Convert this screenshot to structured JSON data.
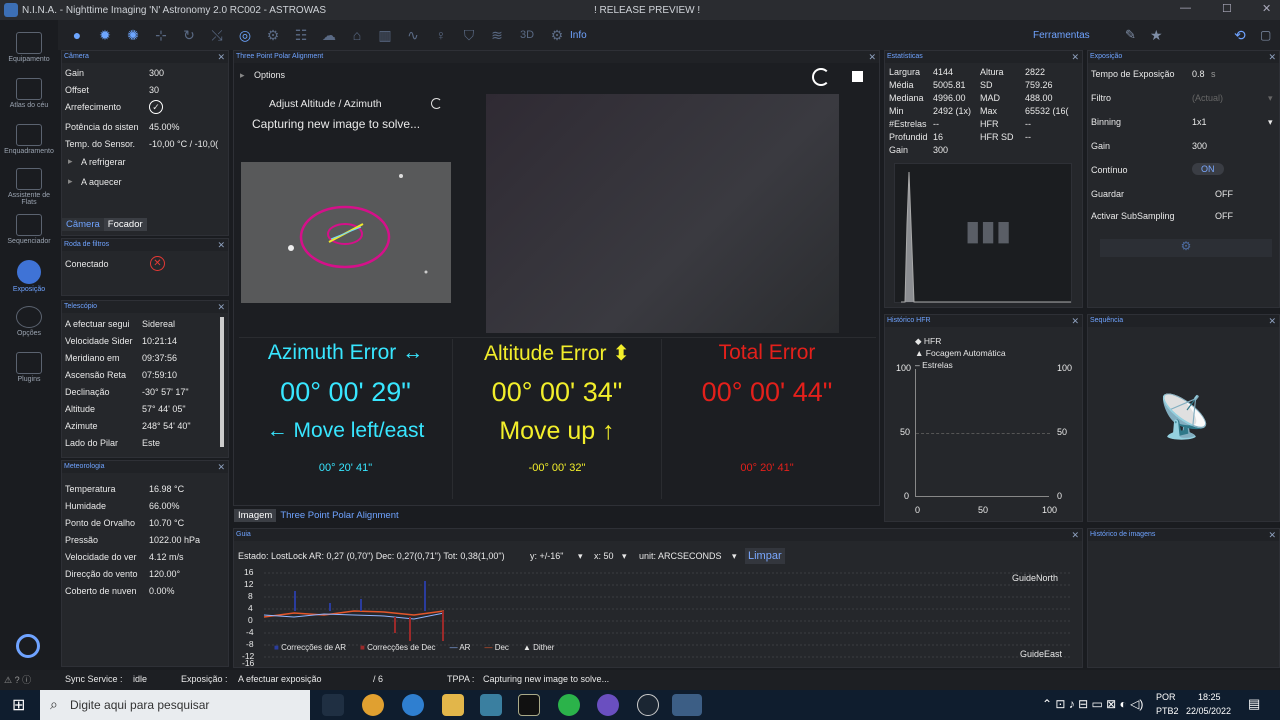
{
  "window": {
    "title": "N.I.N.A. - Nighttime Imaging 'N' Astronomy 2.0 RC002  -  ASTROWAS",
    "center": "! RELEASE PREVIEW !"
  },
  "toolbar": {
    "info": "Info",
    "tools": "Ferramentas",
    "threed": "3D"
  },
  "sidebar": [
    {
      "label": "Equipamento"
    },
    {
      "label": "Atlas do céu"
    },
    {
      "label": "Enquadramento"
    },
    {
      "label": "Assistente de Flats"
    },
    {
      "label": "Sequenciador"
    },
    {
      "label": "Exposição"
    },
    {
      "label": "Opções"
    },
    {
      "label": "Plugins"
    }
  ],
  "camera": {
    "title": "Câmera",
    "rows": [
      [
        "Gain",
        "300"
      ],
      [
        "Offset",
        "30"
      ],
      [
        "Arrefecimento",
        ""
      ],
      [
        "Potência do sisten",
        "45.00%"
      ],
      [
        "Temp. do Sensor.",
        "-10,00 °C / -10,0("
      ]
    ],
    "cool": "A refrigerar",
    "warm": "A aquecer",
    "tab1": "Câmera",
    "tab2": "Focador"
  },
  "filter": {
    "title": "Roda de filtros",
    "connected": "Conectado"
  },
  "telescope": {
    "title": "Telescópio",
    "rows": [
      [
        "A efectuar segui",
        "Sidereal"
      ],
      [
        "Velocidade Sider",
        "10:21:14"
      ],
      [
        "Meridiano em",
        "09:37:56"
      ],
      [
        "Ascensão Reta",
        "07:59:10"
      ],
      [
        "Declinação",
        "-30° 57' 17\""
      ],
      [
        "Altitude",
        "57° 44' 05\""
      ],
      [
        "Azimute",
        "248° 54' 40\""
      ],
      [
        "Lado do Pilar",
        "Este"
      ]
    ]
  },
  "weather": {
    "title": "Meteorologia",
    "rows": [
      [
        "Temperatura",
        "16.98 °C"
      ],
      [
        "Humidade",
        "66.00%"
      ],
      [
        "Ponto de Orvalho",
        "10.70 °C"
      ],
      [
        "Pressão",
        "1022.00 hPa"
      ],
      [
        "Velocidade do ver",
        "4.12 m/s"
      ],
      [
        "Direcção do vento",
        "120.00°"
      ],
      [
        "Coberto de nuven",
        "0.00%"
      ]
    ]
  },
  "tppa": {
    "title": "Three Point Polar Alignment",
    "options": "Options",
    "adjust": "Adjust Altitude / Azimuth",
    "capturing": "Capturing new image to solve...",
    "az": {
      "label": "Azimuth Error ↔",
      "value": "00° 00' 29\"",
      "hint": "← Move left/east",
      "sub": "00° 20' 41\""
    },
    "alt": {
      "label": "Altitude Error ⬍",
      "value": "00° 00' 34\"",
      "hint": "Move up ↑",
      "sub": "-00° 00' 32\""
    },
    "tot": {
      "label": "Total Error",
      "value": "00° 00' 44\"",
      "sub": "00° 20' 41\""
    },
    "tabs": [
      "Imagem",
      "Three Point Polar Alignment"
    ],
    "colors": {
      "az": "#38e6ff",
      "alt": "#f2ee2b",
      "tot": "#e3201b"
    }
  },
  "stats": {
    "title": "Estatísticas",
    "rows": [
      [
        "Largura",
        "4144",
        "Altura",
        "2822"
      ],
      [
        "Média",
        "5005.81",
        "SD",
        "759.26"
      ],
      [
        "Mediana",
        "4996.00",
        "MAD",
        "488.00"
      ],
      [
        "Min",
        "2492 (1x)",
        "Max",
        "65532 (16("
      ],
      [
        "#Estrelas",
        "--",
        "HFR",
        "--"
      ],
      [
        "Profundid",
        "16",
        "HFR SD",
        "--"
      ],
      [
        "Gain",
        "300",
        "",
        ""
      ]
    ]
  },
  "hfr": {
    "title": "Histórico HFR",
    "legend": [
      "HFR",
      "Focagem Automática",
      "Estrelas"
    ],
    "yticks": [
      "100",
      "50",
      "0"
    ],
    "xticks": [
      "0",
      "50",
      "100"
    ]
  },
  "exposure": {
    "title": "Exposição",
    "rows": [
      [
        "Tempo de Exposição",
        "0.8",
        "s"
      ],
      [
        "Filtro",
        "(Actual)",
        ""
      ],
      [
        "Binning",
        "1x1",
        ""
      ],
      [
        "Gain",
        "300",
        ""
      ],
      [
        "Contínuo",
        "ON",
        ""
      ],
      [
        "Guardar",
        "OFF",
        ""
      ],
      [
        "Activar SubSampling",
        "OFF",
        ""
      ]
    ]
  },
  "sequence": {
    "title": "Sequência"
  },
  "imghist": {
    "title": "Histórico de imagens"
  },
  "guide": {
    "title": "Guia",
    "status": "Estado: LostLock  AR: 0,27 (0,70\")  Dec: 0,27(0,71\")  Tot: 0,38(1,00\")",
    "y": "y: +/-16\"",
    "x": "x: 50",
    "unit": "unit: ARCSECONDS",
    "clear": "Limpar",
    "yticks": [
      "16",
      "12",
      "8",
      "4",
      "0",
      "-4",
      "-8",
      "-12",
      "-16"
    ],
    "north": "GuideNorth",
    "east": "GuideEast",
    "legend": [
      "Correcções de AR",
      "Correcções de Dec",
      "AR",
      "Dec",
      "Dither"
    ]
  },
  "status": {
    "sync": "Sync Service :",
    "sync_v": "idle",
    "exp": "Exposição :",
    "exp_v": "A efectuar exposição",
    "count": "/ 6",
    "tppa": "TPPA :",
    "tppa_v": "Capturing new image to solve..."
  },
  "taskbar": {
    "search": "Digite aqui para pesquisar",
    "lang1": "POR",
    "lang2": "PTB2",
    "time": "18:25",
    "date": "22/05/2022"
  }
}
